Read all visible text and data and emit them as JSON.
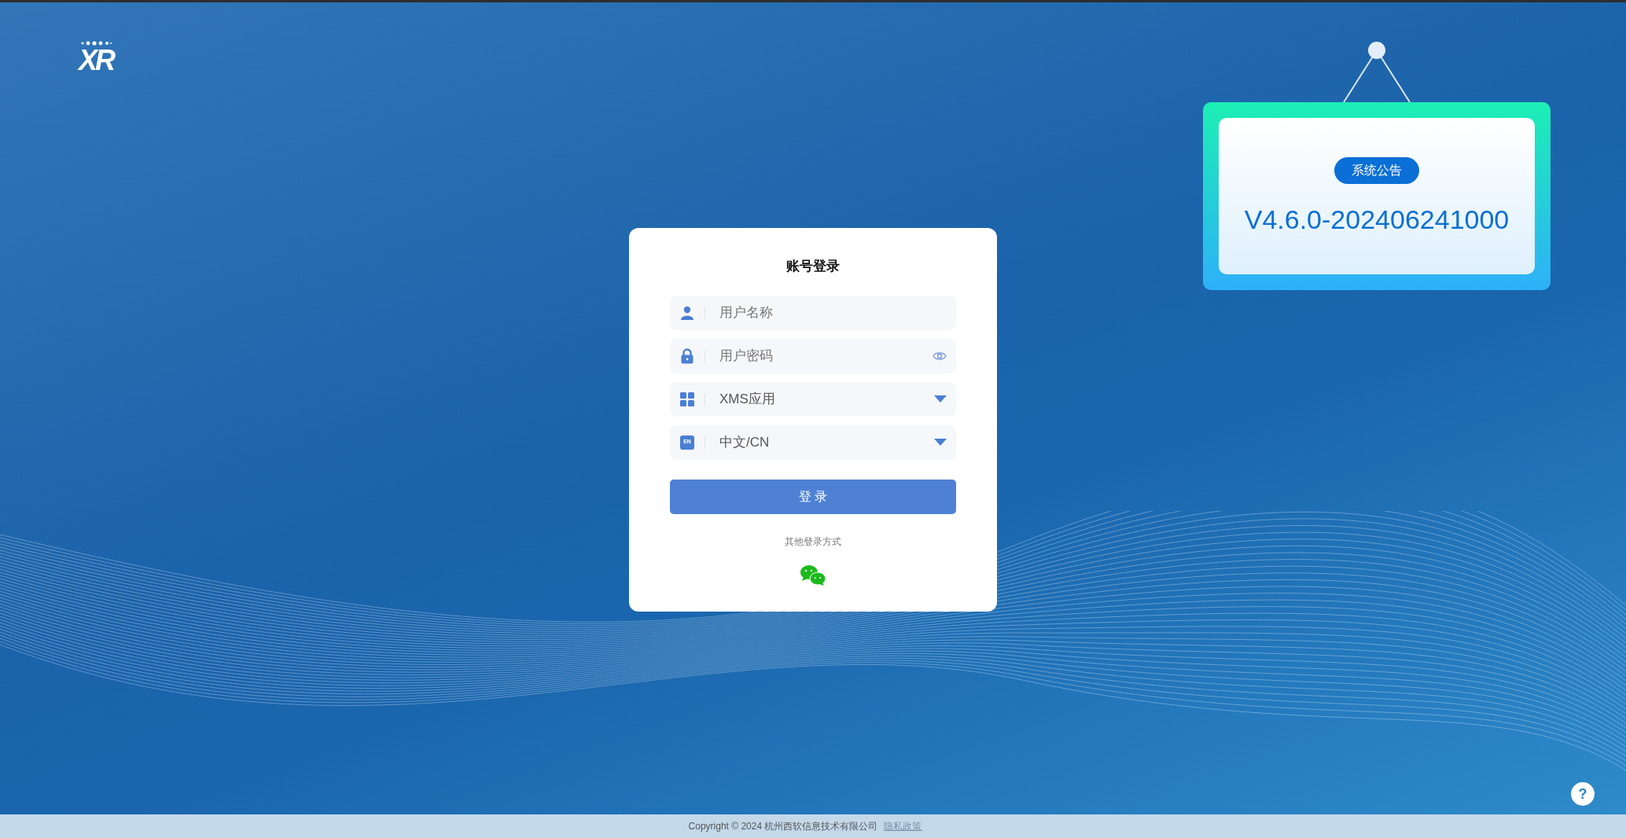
{
  "logo": {
    "text": "XR"
  },
  "notice": {
    "badge": "系统公告",
    "version": "V4.6.0-202406241000"
  },
  "login": {
    "title": "账号登录",
    "fields": [
      {
        "kind": "user",
        "placeholder": "用户名称"
      },
      {
        "kind": "password",
        "placeholder": "用户密码"
      },
      {
        "kind": "app",
        "value": "XMS应用"
      },
      {
        "kind": "language",
        "badge": "EN",
        "value": "中文/CN"
      }
    ],
    "submit": "登 录",
    "other_label": "其他登录方式"
  },
  "help_button": {
    "label": "?"
  },
  "footer": {
    "copyright": "Copyright © 2024 杭州西软信息技术有限公司",
    "link": "隐私政策"
  }
}
